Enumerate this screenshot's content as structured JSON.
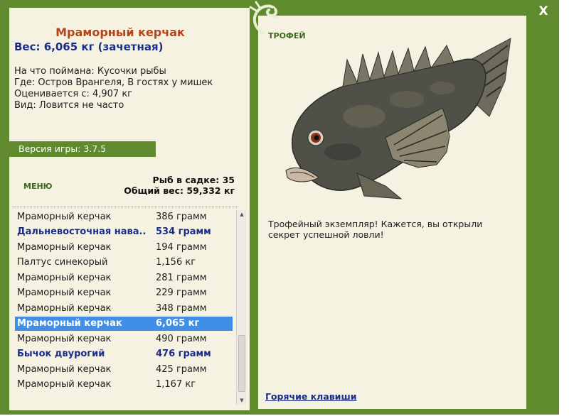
{
  "colors": {
    "frame": "#5f8a2e",
    "panel": "#f5f2e1",
    "title": "#b4441a",
    "accent": "#1a2d8a",
    "selection": "#3f8fe8"
  },
  "window": {
    "close_label": "X",
    "logo_icon": "lizard-logo-icon"
  },
  "catch": {
    "name": "Мраморный керчак",
    "weight": "Вес: 6,065 кг (зачетная)",
    "bait": "На что поймана: Кусочки рыбы",
    "location": "Где: Остров Врангеля, В гостях у мишек",
    "value": "Оценивается с: 4,907 кг",
    "kind": "Вид: Ловится не часто"
  },
  "version": "Версия игры: 3.7.5",
  "menu_label": "МЕНЮ",
  "keepnet": {
    "count": "Рыб в садке: 35",
    "total": "Общий вес: 59,332 кг"
  },
  "list": [
    {
      "name": "Мраморный керчак",
      "weight": "386 грамм"
    },
    {
      "name": "Дальневосточная нава...",
      "weight": "534 грамм"
    },
    {
      "name": "Мраморный керчак",
      "weight": "194 грамм"
    },
    {
      "name": "Палтус синекорый",
      "weight": "1,156 кг"
    },
    {
      "name": "Мраморный керчак",
      "weight": "281 грамм"
    },
    {
      "name": "Мраморный керчак",
      "weight": "229 грамм"
    },
    {
      "name": "Мраморный керчак",
      "weight": "348 грамм"
    },
    {
      "name": "Мраморный керчак",
      "weight": "6,065 кг"
    },
    {
      "name": "Мраморный керчак",
      "weight": "490 грамм"
    },
    {
      "name": "Бычок двурогий",
      "weight": "476 грамм"
    },
    {
      "name": "Мраморный керчак",
      "weight": "425 грамм"
    },
    {
      "name": "Мраморный керчак",
      "weight": "1,167 кг"
    }
  ],
  "trophy_label": "ТРОФЕЙ",
  "description": "Трофейный экземпляр! Кажется, вы открыли секрет успешной ловли!",
  "hotkeys_label": "Горячие клавиши"
}
